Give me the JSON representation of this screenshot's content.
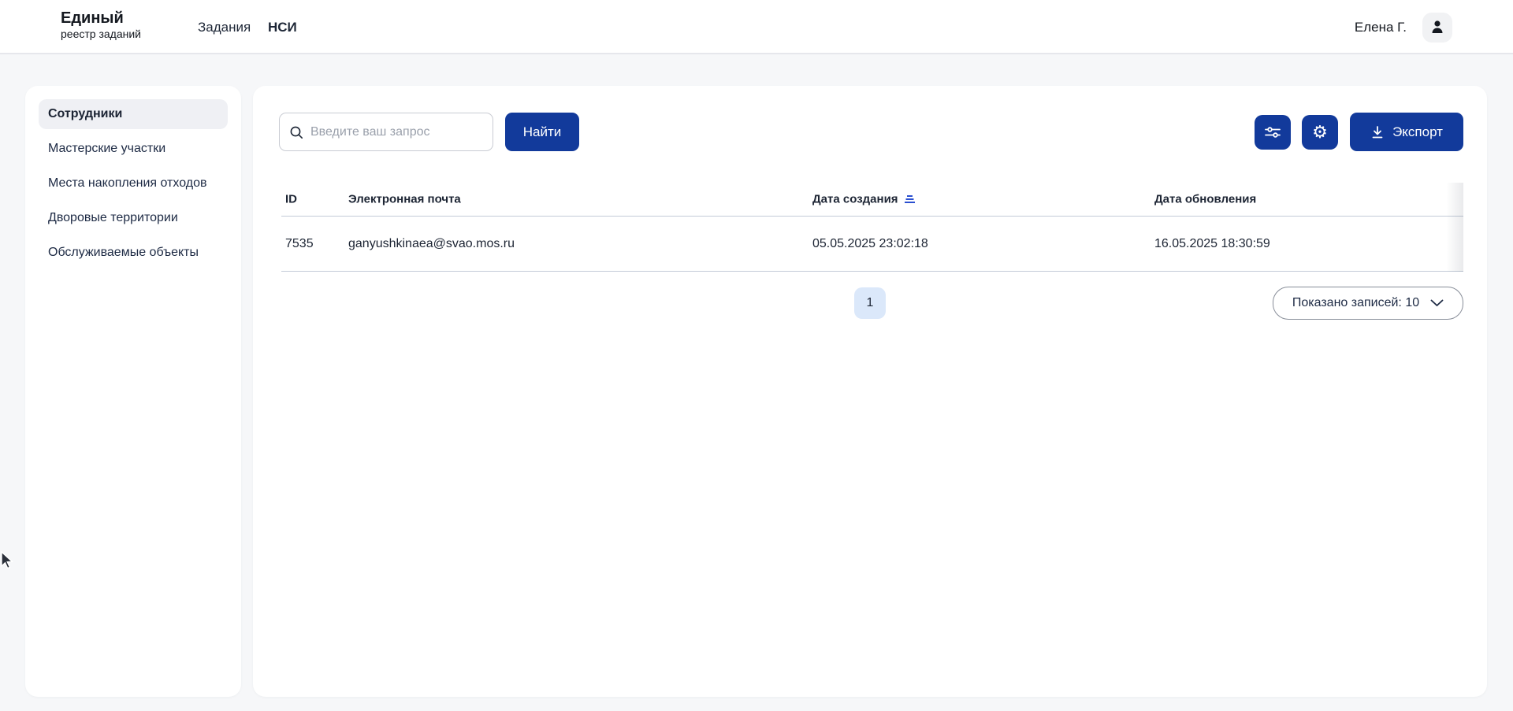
{
  "header": {
    "logo_title": "Единый",
    "logo_subtitle": "реестр заданий",
    "nav": [
      {
        "label": "Задания",
        "active": false
      },
      {
        "label": "НСИ",
        "active": true
      }
    ],
    "user_name": "Елена Г."
  },
  "sidebar": {
    "items": [
      {
        "label": "Сотрудники",
        "active": true
      },
      {
        "label": "Мастерские участки",
        "active": false
      },
      {
        "label": "Места накопления отходов",
        "active": false
      },
      {
        "label": "Дворовые территории",
        "active": false
      },
      {
        "label": "Обслуживаемые объекты",
        "active": false
      }
    ]
  },
  "toolbar": {
    "search_placeholder": "Введите ваш запрос",
    "search_value": "",
    "find_label": "Найти",
    "export_label": "Экспорт"
  },
  "table": {
    "columns": [
      "ID",
      "Электронная почта",
      "Дата создания",
      "Дата обновления"
    ],
    "sorted_column": "Дата создания",
    "rows": [
      {
        "id": "7535",
        "email": "ganyushkinaea@svao.mos.ru",
        "created": "05.05.2025 23:02:18",
        "updated": "16.05.2025 18:30:59"
      }
    ]
  },
  "pagination": {
    "current_page": "1",
    "page_size_label": "Показано записей: 10"
  },
  "colors": {
    "primary_button": "#123a9b",
    "page_background": "#f6f7f9",
    "active_item_background": "#eff0f4",
    "page_chip_background": "#dbe8fa",
    "sort_icon": "#2b50d0",
    "table_border": "#c3cbd7"
  }
}
